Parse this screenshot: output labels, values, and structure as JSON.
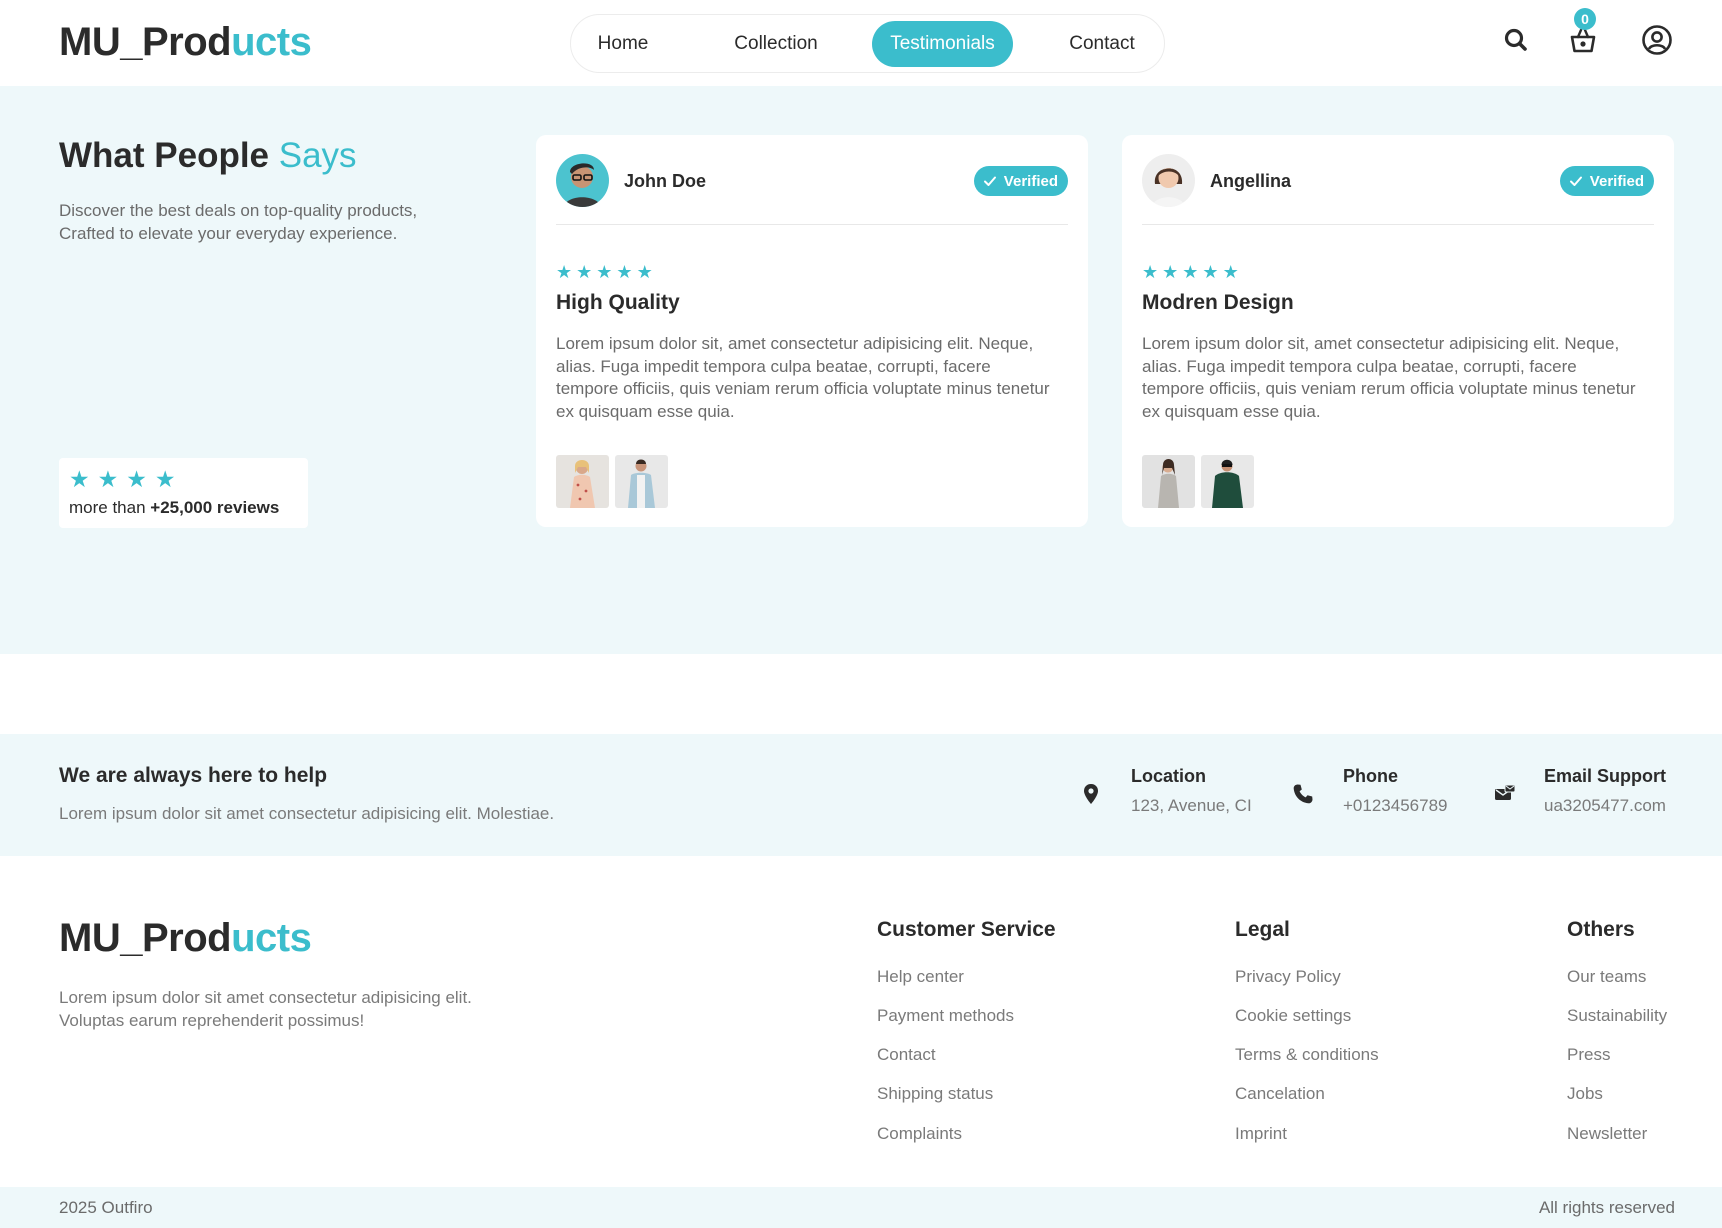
{
  "header": {
    "logo_main": "MU_Prod",
    "logo_accent": "ucts",
    "nav": [
      {
        "label": "Home",
        "active": false
      },
      {
        "label": "Collection",
        "active": false
      },
      {
        "label": "Testimonials",
        "active": true
      },
      {
        "label": "Contact",
        "active": false
      }
    ],
    "cart_count": "0",
    "icons": [
      "search-icon",
      "cart-icon",
      "user-icon"
    ]
  },
  "testimonials": {
    "title_main": "What People ",
    "title_accent": "Says",
    "description": "Discover the best deals on top-quality products, Crafted to elevate your everyday experience.",
    "summary_stars": 4,
    "summary_prefix": "more than ",
    "summary_count": "+25,000 reviews",
    "cards": [
      {
        "name": "John Doe",
        "badge": "Verified",
        "rating": 5,
        "title": "High Quality",
        "text": "Lorem ipsum dolor sit, amet consectetur adipisicing elit. Neque, alias. Fuga impedit tempora culpa beatae, corrupti, facere tempore officiis, quis veniam rerum officia voluptate minus tenetur ex quisquam esse quia."
      },
      {
        "name": "Angellina",
        "badge": "Verified",
        "rating": 5,
        "title": "Modren Design",
        "text": "Lorem ipsum dolor sit, amet consectetur adipisicing elit. Neque, alias. Fuga impedit tempora culpa beatae, corrupti, facere tempore officiis, quis veniam rerum officia voluptate minus tenetur ex quisquam esse quia."
      }
    ]
  },
  "help": {
    "title": "We are always here to help",
    "subtitle": "Lorem ipsum dolor sit amet consectetur adipisicing elit. Molestiae.",
    "contacts": [
      {
        "label": "Location",
        "value": "123, Avenue, CI",
        "icon": "location-pin-icon"
      },
      {
        "label": "Phone",
        "value": "+0123456789",
        "icon": "phone-icon"
      },
      {
        "label": "Email Support",
        "value": "ua3205477.com",
        "icon": "email-support-icon"
      }
    ]
  },
  "footer": {
    "logo_main": "MU_Prod",
    "logo_accent": "ucts",
    "description": "Lorem ipsum dolor sit amet consectetur adipisicing elit. Voluptas earum reprehenderit possimus!",
    "columns": [
      {
        "heading": "Customer Service",
        "links": [
          "Help center",
          "Payment methods",
          "Contact",
          "Shipping status",
          "Complaints"
        ]
      },
      {
        "heading": "Legal",
        "links": [
          "Privacy Policy",
          "Cookie settings",
          "Terms & conditions",
          "Cancelation",
          "Imprint"
        ]
      },
      {
        "heading": "Others",
        "links": [
          "Our teams",
          "Sustainability",
          "Press",
          "Jobs",
          "Newsletter"
        ]
      }
    ],
    "copyright": "2025 Outfiro",
    "rights": "All rights reserved"
  },
  "colors": {
    "accent": "#3bbdcc",
    "tint_background": "#eef8fa",
    "text": "#2b2b2b",
    "muted": "#7a7a7a"
  }
}
